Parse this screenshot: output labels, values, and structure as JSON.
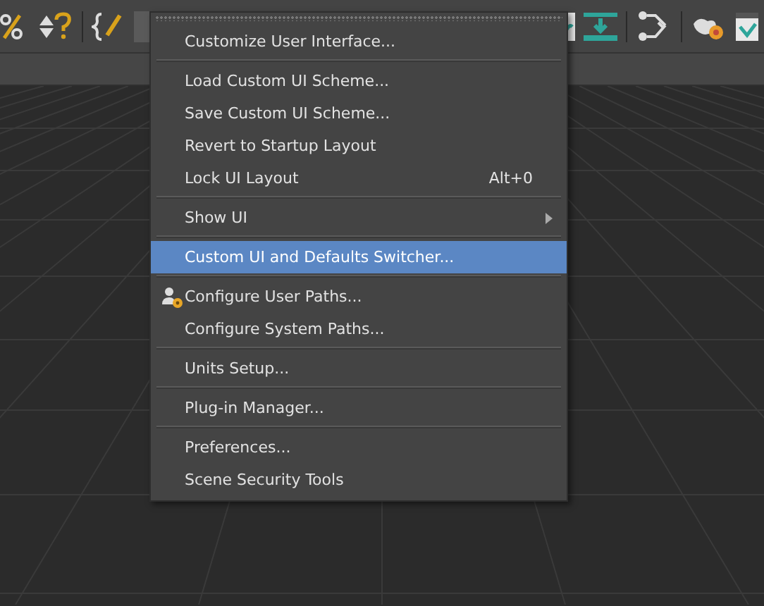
{
  "menu": {
    "groups": [
      [
        {
          "kind": "command",
          "label": "Customize User Interface...",
          "selected": false
        }
      ],
      [
        {
          "kind": "command",
          "label": "Load Custom UI Scheme...",
          "selected": false
        },
        {
          "kind": "command",
          "label": "Save Custom UI Scheme...",
          "selected": false
        },
        {
          "kind": "command",
          "label": "Revert to Startup Layout",
          "selected": false
        },
        {
          "kind": "command",
          "label": "Lock UI Layout",
          "shortcut": "Alt+0",
          "selected": false
        }
      ],
      [
        {
          "kind": "submenu",
          "label": "Show UI",
          "selected": false
        }
      ],
      [
        {
          "kind": "command",
          "label": "Custom UI and Defaults Switcher...",
          "selected": true
        }
      ],
      [
        {
          "kind": "icon-command",
          "label": "Configure User Paths...",
          "selected": false
        },
        {
          "kind": "command",
          "label": "Configure System Paths...",
          "selected": false
        }
      ],
      [
        {
          "kind": "command",
          "label": "Units Setup...",
          "selected": false
        }
      ],
      [
        {
          "kind": "command",
          "label": "Plug-in Manager...",
          "selected": false
        }
      ],
      [
        {
          "kind": "command",
          "label": "Preferences...",
          "selected": false
        },
        {
          "kind": "command",
          "label": "Scene Security Tools",
          "selected": false
        }
      ]
    ]
  }
}
